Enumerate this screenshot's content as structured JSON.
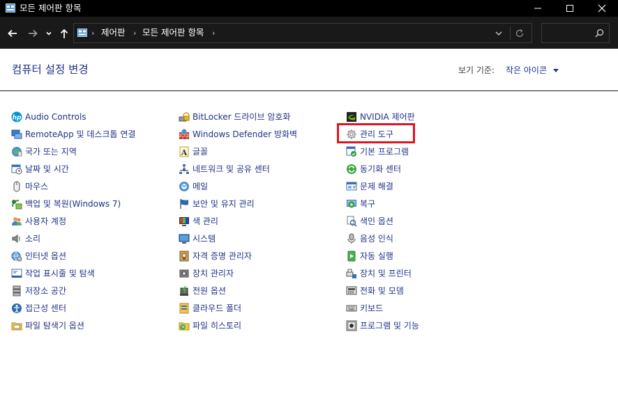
{
  "window": {
    "title": "모든 제어판 항목"
  },
  "address_bar": {
    "crumbs": [
      "제어판",
      "모든 제어판 항목"
    ]
  },
  "search": {
    "placeholder": ""
  },
  "header": {
    "title": "컴퓨터 설정 변경",
    "view_by_label": "보기 기준:",
    "view_by_value": "작은 아이콘"
  },
  "items": {
    "col1": [
      {
        "label": "Audio Controls",
        "icon": "hp-icon"
      },
      {
        "label": "RemoteApp 및 데스크톱 연결",
        "icon": "remoteapp-icon"
      },
      {
        "label": "국가 또는 지역",
        "icon": "region-icon"
      },
      {
        "label": "날짜 및 시간",
        "icon": "datetime-icon"
      },
      {
        "label": "마우스",
        "icon": "mouse-icon"
      },
      {
        "label": "백업 및 복원(Windows 7)",
        "icon": "backup-icon"
      },
      {
        "label": "사용자 계정",
        "icon": "user-accounts-icon"
      },
      {
        "label": "소리",
        "icon": "sound-icon"
      },
      {
        "label": "인터넷 옵션",
        "icon": "internet-options-icon"
      },
      {
        "label": "작업 표시줄 및 탐색",
        "icon": "taskbar-icon"
      },
      {
        "label": "저장소 공간",
        "icon": "storage-icon"
      },
      {
        "label": "접근성 센터",
        "icon": "ease-of-access-icon"
      },
      {
        "label": "파일 탐색기 옵션",
        "icon": "folder-options-icon"
      }
    ],
    "col2": [
      {
        "label": "BitLocker 드라이브 암호화",
        "icon": "bitlocker-icon"
      },
      {
        "label": "Windows Defender 방화벽",
        "icon": "firewall-icon"
      },
      {
        "label": "글꼴",
        "icon": "fonts-icon"
      },
      {
        "label": "네트워크 및 공유 센터",
        "icon": "network-icon"
      },
      {
        "label": "메일",
        "icon": "mail-icon"
      },
      {
        "label": "보안 및 유지 관리",
        "icon": "flag-icon"
      },
      {
        "label": "색 관리",
        "icon": "color-management-icon"
      },
      {
        "label": "시스템",
        "icon": "system-icon"
      },
      {
        "label": "자격 증명 관리자",
        "icon": "credential-icon"
      },
      {
        "label": "장치 관리자",
        "icon": "device-manager-icon"
      },
      {
        "label": "전원 옵션",
        "icon": "power-icon"
      },
      {
        "label": "클라우드 폴더",
        "icon": "cloud-folder-icon"
      },
      {
        "label": "파일 히스토리",
        "icon": "file-history-icon"
      }
    ],
    "col3": [
      {
        "label": "NVIDIA 제어판",
        "icon": "nvidia-icon"
      },
      {
        "label": "관리 도구",
        "icon": "admin-tools-icon"
      },
      {
        "label": "기본 프로그램",
        "icon": "default-programs-icon"
      },
      {
        "label": "동기화 센터",
        "icon": "sync-icon"
      },
      {
        "label": "문제 해결",
        "icon": "troubleshoot-icon"
      },
      {
        "label": "복구",
        "icon": "recovery-icon"
      },
      {
        "label": "색인 옵션",
        "icon": "indexing-icon"
      },
      {
        "label": "음성 인식",
        "icon": "speech-icon"
      },
      {
        "label": "자동 실행",
        "icon": "autoplay-icon"
      },
      {
        "label": "장치 및 프린터",
        "icon": "devices-printers-icon"
      },
      {
        "label": "전화 및 모뎀",
        "icon": "phone-modem-icon"
      },
      {
        "label": "키보드",
        "icon": "keyboard-icon"
      },
      {
        "label": "프로그램 및 기능",
        "icon": "programs-features-icon"
      }
    ]
  },
  "highlighted_item": "관리 도구",
  "colors": {
    "link": "#1e3287",
    "highlight": "#e0141e",
    "titlebar": "#000000",
    "navbar": "#191919"
  }
}
